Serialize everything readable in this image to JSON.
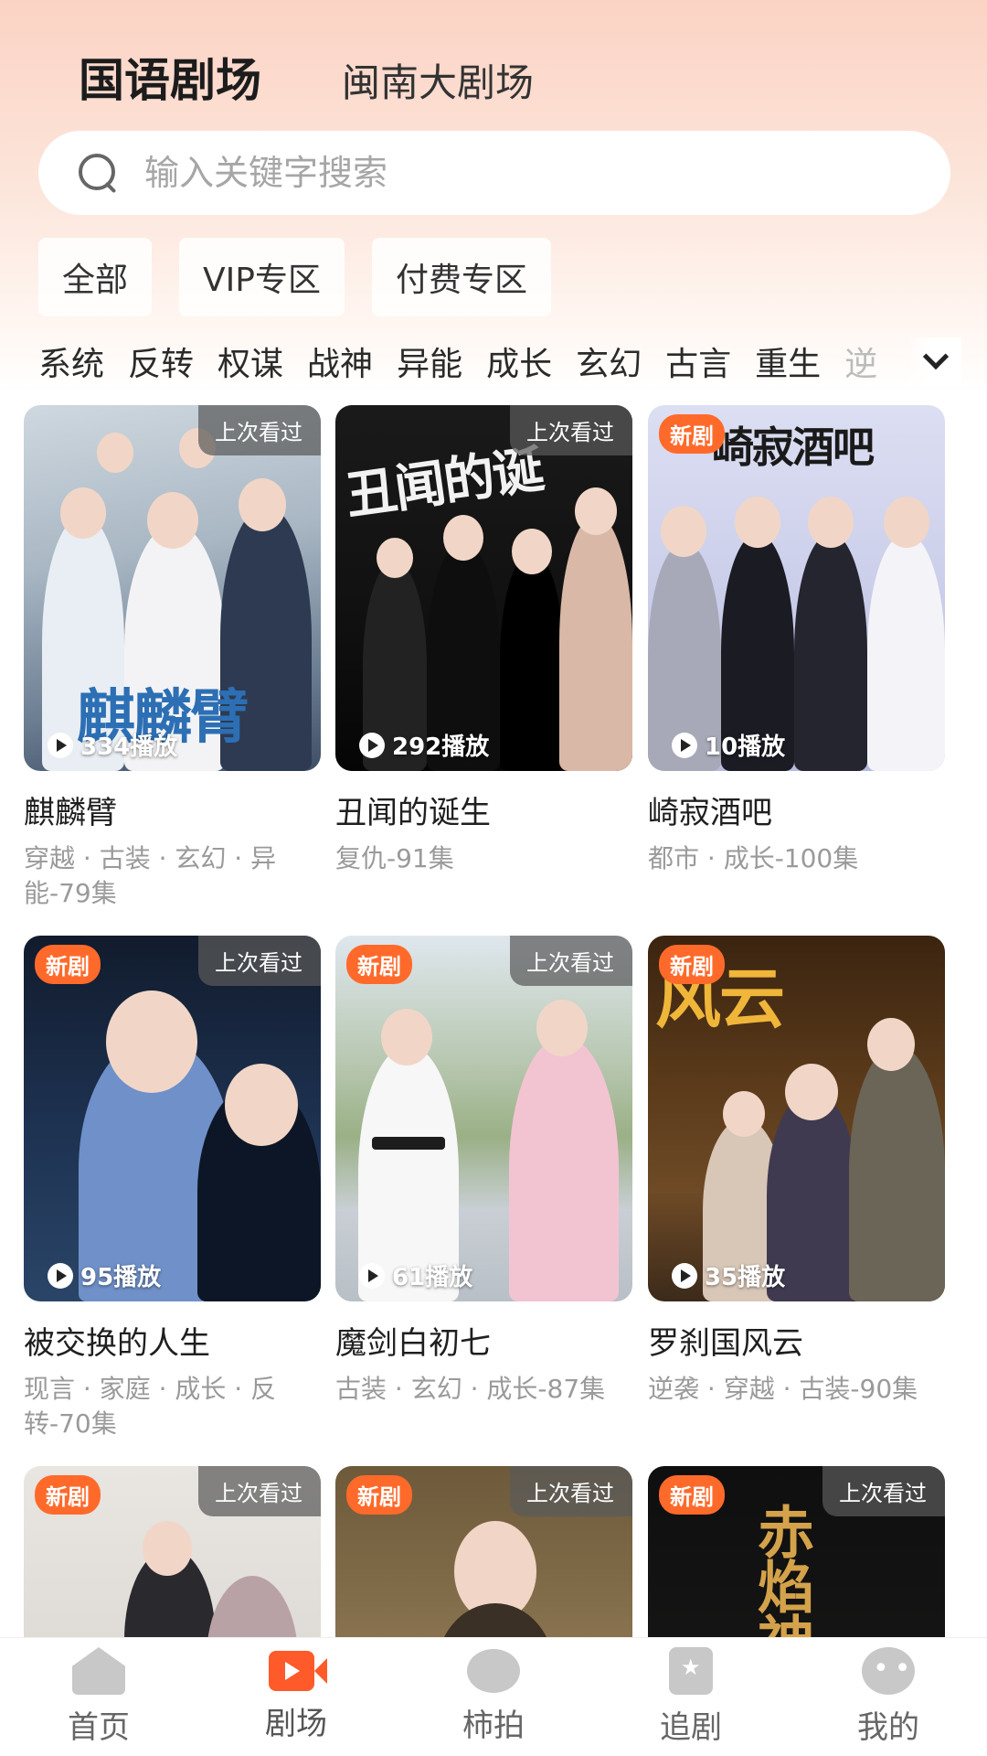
{
  "header": {
    "tabs": [
      {
        "label": "国语剧场",
        "active": true
      },
      {
        "label": "闽南大剧场",
        "active": false
      }
    ]
  },
  "search": {
    "placeholder": "输入关键字搜索"
  },
  "filters": [
    "全部",
    "VIP专区",
    "付费专区"
  ],
  "genres": [
    "系统",
    "反转",
    "权谋",
    "战神",
    "异能",
    "成长",
    "玄幻",
    "古言",
    "重生",
    "逆"
  ],
  "dramas": [
    {
      "title": "麒麟臂",
      "meta": "穿越 · 古装 · 玄幻 · 异能-79集",
      "plays": "334播放",
      "new": false,
      "last_watched": true,
      "caption": "麒麟臂"
    },
    {
      "title": "丑闻的诞生",
      "meta": "复仇-91集",
      "plays": "292播放",
      "new": false,
      "last_watched": true,
      "caption": "丑闻的诞"
    },
    {
      "title": "崎寂酒吧",
      "meta": "都市 · 成长-100集",
      "plays": "10播放",
      "new": true,
      "last_watched": false,
      "caption": "崎寂酒吧"
    },
    {
      "title": "被交换的人生",
      "meta": "现言 · 家庭 · 成长 · 反转-70集",
      "plays": "95播放",
      "new": true,
      "last_watched": true,
      "caption": ""
    },
    {
      "title": "魔剑白初七",
      "meta": "古装 · 玄幻 · 成长-87集",
      "plays": "61播放",
      "new": true,
      "last_watched": true,
      "caption": ""
    },
    {
      "title": "罗刹国风云",
      "meta": "逆袭 · 穿越 · 古装-90集",
      "plays": "35播放",
      "new": true,
      "last_watched": false,
      "caption": "风云"
    },
    {
      "title": "",
      "meta": "",
      "plays": "",
      "new": true,
      "last_watched": true,
      "caption": ""
    },
    {
      "title": "",
      "meta": "",
      "plays": "",
      "new": true,
      "last_watched": true,
      "caption": ""
    },
    {
      "title": "",
      "meta": "",
      "plays": "",
      "new": true,
      "last_watched": true,
      "caption": "赤焰神"
    }
  ],
  "labels": {
    "new": "新剧",
    "last_watched": "上次看过"
  },
  "bottom_nav": [
    {
      "label": "首页",
      "icon": "home-icon",
      "active": false
    },
    {
      "label": "剧场",
      "icon": "video-icon",
      "active": true
    },
    {
      "label": "柿拍",
      "icon": "persimmon-icon",
      "active": false
    },
    {
      "label": "追剧",
      "icon": "bookmark-star-icon",
      "active": false
    },
    {
      "label": "我的",
      "icon": "profile-icon",
      "active": false
    }
  ],
  "colors": {
    "accent": "#ff5a2a",
    "new_badge": "#ff6a2b"
  }
}
